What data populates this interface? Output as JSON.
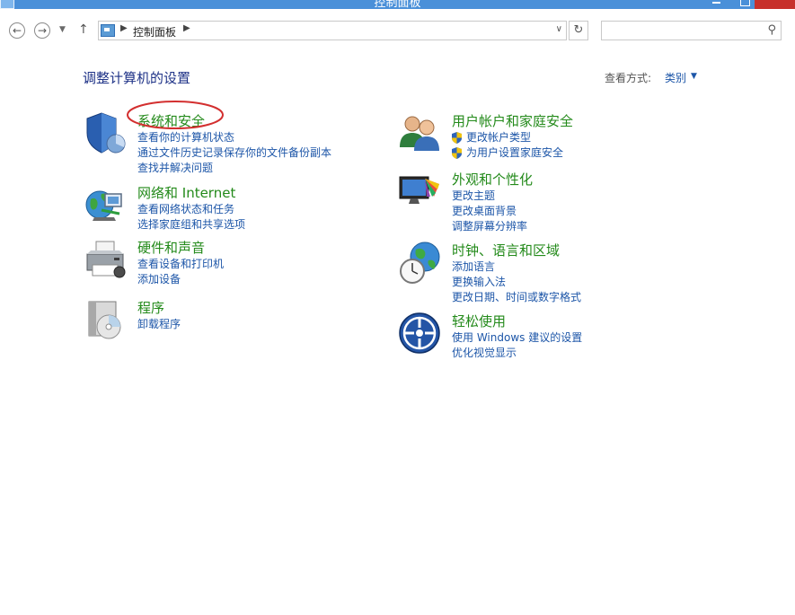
{
  "window": {
    "title": "控制面板"
  },
  "address_bar": {
    "crumb": "控制面板",
    "separator": "▶",
    "dropdown": "∨"
  },
  "search": {
    "placeholder": ""
  },
  "page": {
    "title": "调整计算机的设置",
    "view_by_label": "查看方式:",
    "view_by_value": "类别"
  },
  "categories": [
    {
      "title": "系统和安全",
      "icon": "shield-icon",
      "links": [
        "查看你的计算机状态",
        "通过文件历史记录保存你的文件备份副本",
        "查找并解决问题"
      ]
    },
    {
      "title": "网络和 Internet",
      "icon": "network-globe-icon",
      "links": [
        "查看网络状态和任务",
        "选择家庭组和共享选项"
      ]
    },
    {
      "title": "硬件和声音",
      "icon": "printer-icon",
      "links": [
        "查看设备和打印机",
        "添加设备"
      ]
    },
    {
      "title": "程序",
      "icon": "programs-disc-icon",
      "links": [
        "卸载程序"
      ]
    },
    {
      "title": "用户帐户和家庭安全",
      "icon": "users-icon",
      "links": [
        "更改帐户类型",
        "为用户设置家庭安全"
      ]
    },
    {
      "title": "外观和个性化",
      "icon": "monitor-palette-icon",
      "links": [
        "更改主题",
        "更改桌面背景",
        "调整屏幕分辨率"
      ]
    },
    {
      "title": "时钟、语言和区域",
      "icon": "clock-globe-icon",
      "links": [
        "添加语言",
        "更换输入法",
        "更改日期、时间或数字格式"
      ]
    },
    {
      "title": "轻松使用",
      "icon": "ease-of-access-icon",
      "links": [
        "使用 Windows 建议的设置",
        "优化视觉显示"
      ]
    }
  ],
  "colors": {
    "title_bar": "#4a90d9",
    "heading_green": "#238a1a",
    "link_blue": "#1d56a8",
    "highlight_red": "#d32f2f"
  }
}
